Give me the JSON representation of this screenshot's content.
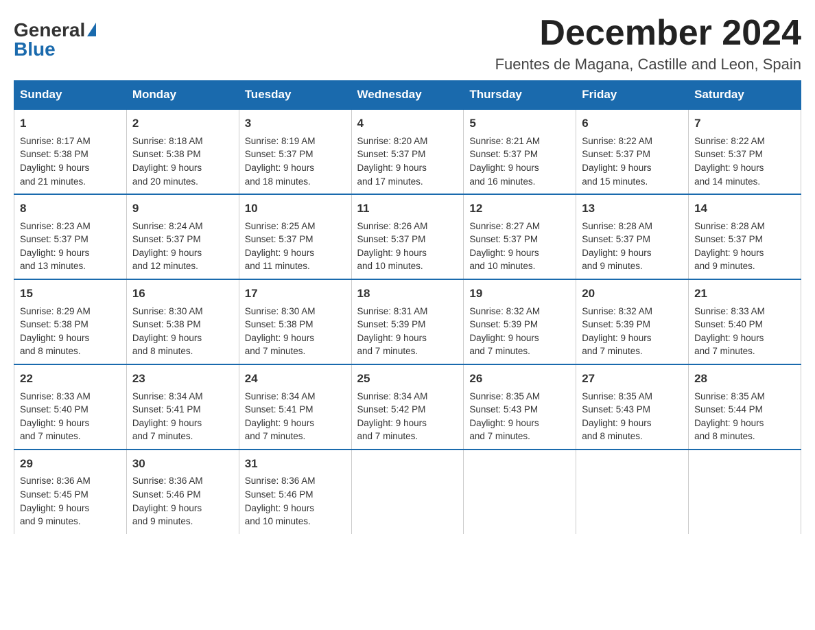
{
  "header": {
    "logo_general": "General",
    "logo_blue": "Blue",
    "month_title": "December 2024",
    "location": "Fuentes de Magana, Castille and Leon, Spain"
  },
  "days_of_week": [
    "Sunday",
    "Monday",
    "Tuesday",
    "Wednesday",
    "Thursday",
    "Friday",
    "Saturday"
  ],
  "weeks": [
    [
      {
        "day": 1,
        "sunrise": "8:17 AM",
        "sunset": "5:38 PM",
        "daylight": "9 hours and 21 minutes."
      },
      {
        "day": 2,
        "sunrise": "8:18 AM",
        "sunset": "5:38 PM",
        "daylight": "9 hours and 20 minutes."
      },
      {
        "day": 3,
        "sunrise": "8:19 AM",
        "sunset": "5:37 PM",
        "daylight": "9 hours and 18 minutes."
      },
      {
        "day": 4,
        "sunrise": "8:20 AM",
        "sunset": "5:37 PM",
        "daylight": "9 hours and 17 minutes."
      },
      {
        "day": 5,
        "sunrise": "8:21 AM",
        "sunset": "5:37 PM",
        "daylight": "9 hours and 16 minutes."
      },
      {
        "day": 6,
        "sunrise": "8:22 AM",
        "sunset": "5:37 PM",
        "daylight": "9 hours and 15 minutes."
      },
      {
        "day": 7,
        "sunrise": "8:22 AM",
        "sunset": "5:37 PM",
        "daylight": "9 hours and 14 minutes."
      }
    ],
    [
      {
        "day": 8,
        "sunrise": "8:23 AM",
        "sunset": "5:37 PM",
        "daylight": "9 hours and 13 minutes."
      },
      {
        "day": 9,
        "sunrise": "8:24 AM",
        "sunset": "5:37 PM",
        "daylight": "9 hours and 12 minutes."
      },
      {
        "day": 10,
        "sunrise": "8:25 AM",
        "sunset": "5:37 PM",
        "daylight": "9 hours and 11 minutes."
      },
      {
        "day": 11,
        "sunrise": "8:26 AM",
        "sunset": "5:37 PM",
        "daylight": "9 hours and 10 minutes."
      },
      {
        "day": 12,
        "sunrise": "8:27 AM",
        "sunset": "5:37 PM",
        "daylight": "9 hours and 10 minutes."
      },
      {
        "day": 13,
        "sunrise": "8:28 AM",
        "sunset": "5:37 PM",
        "daylight": "9 hours and 9 minutes."
      },
      {
        "day": 14,
        "sunrise": "8:28 AM",
        "sunset": "5:37 PM",
        "daylight": "9 hours and 9 minutes."
      }
    ],
    [
      {
        "day": 15,
        "sunrise": "8:29 AM",
        "sunset": "5:38 PM",
        "daylight": "9 hours and 8 minutes."
      },
      {
        "day": 16,
        "sunrise": "8:30 AM",
        "sunset": "5:38 PM",
        "daylight": "9 hours and 8 minutes."
      },
      {
        "day": 17,
        "sunrise": "8:30 AM",
        "sunset": "5:38 PM",
        "daylight": "9 hours and 7 minutes."
      },
      {
        "day": 18,
        "sunrise": "8:31 AM",
        "sunset": "5:39 PM",
        "daylight": "9 hours and 7 minutes."
      },
      {
        "day": 19,
        "sunrise": "8:32 AM",
        "sunset": "5:39 PM",
        "daylight": "9 hours and 7 minutes."
      },
      {
        "day": 20,
        "sunrise": "8:32 AM",
        "sunset": "5:39 PM",
        "daylight": "9 hours and 7 minutes."
      },
      {
        "day": 21,
        "sunrise": "8:33 AM",
        "sunset": "5:40 PM",
        "daylight": "9 hours and 7 minutes."
      }
    ],
    [
      {
        "day": 22,
        "sunrise": "8:33 AM",
        "sunset": "5:40 PM",
        "daylight": "9 hours and 7 minutes."
      },
      {
        "day": 23,
        "sunrise": "8:34 AM",
        "sunset": "5:41 PM",
        "daylight": "9 hours and 7 minutes."
      },
      {
        "day": 24,
        "sunrise": "8:34 AM",
        "sunset": "5:41 PM",
        "daylight": "9 hours and 7 minutes."
      },
      {
        "day": 25,
        "sunrise": "8:34 AM",
        "sunset": "5:42 PM",
        "daylight": "9 hours and 7 minutes."
      },
      {
        "day": 26,
        "sunrise": "8:35 AM",
        "sunset": "5:43 PM",
        "daylight": "9 hours and 7 minutes."
      },
      {
        "day": 27,
        "sunrise": "8:35 AM",
        "sunset": "5:43 PM",
        "daylight": "9 hours and 8 minutes."
      },
      {
        "day": 28,
        "sunrise": "8:35 AM",
        "sunset": "5:44 PM",
        "daylight": "9 hours and 8 minutes."
      }
    ],
    [
      {
        "day": 29,
        "sunrise": "8:36 AM",
        "sunset": "5:45 PM",
        "daylight": "9 hours and 9 minutes."
      },
      {
        "day": 30,
        "sunrise": "8:36 AM",
        "sunset": "5:46 PM",
        "daylight": "9 hours and 9 minutes."
      },
      {
        "day": 31,
        "sunrise": "8:36 AM",
        "sunset": "5:46 PM",
        "daylight": "9 hours and 10 minutes."
      },
      null,
      null,
      null,
      null
    ]
  ],
  "cell_labels": {
    "sunrise": "Sunrise: ",
    "sunset": "Sunset: ",
    "daylight": "Daylight: "
  }
}
